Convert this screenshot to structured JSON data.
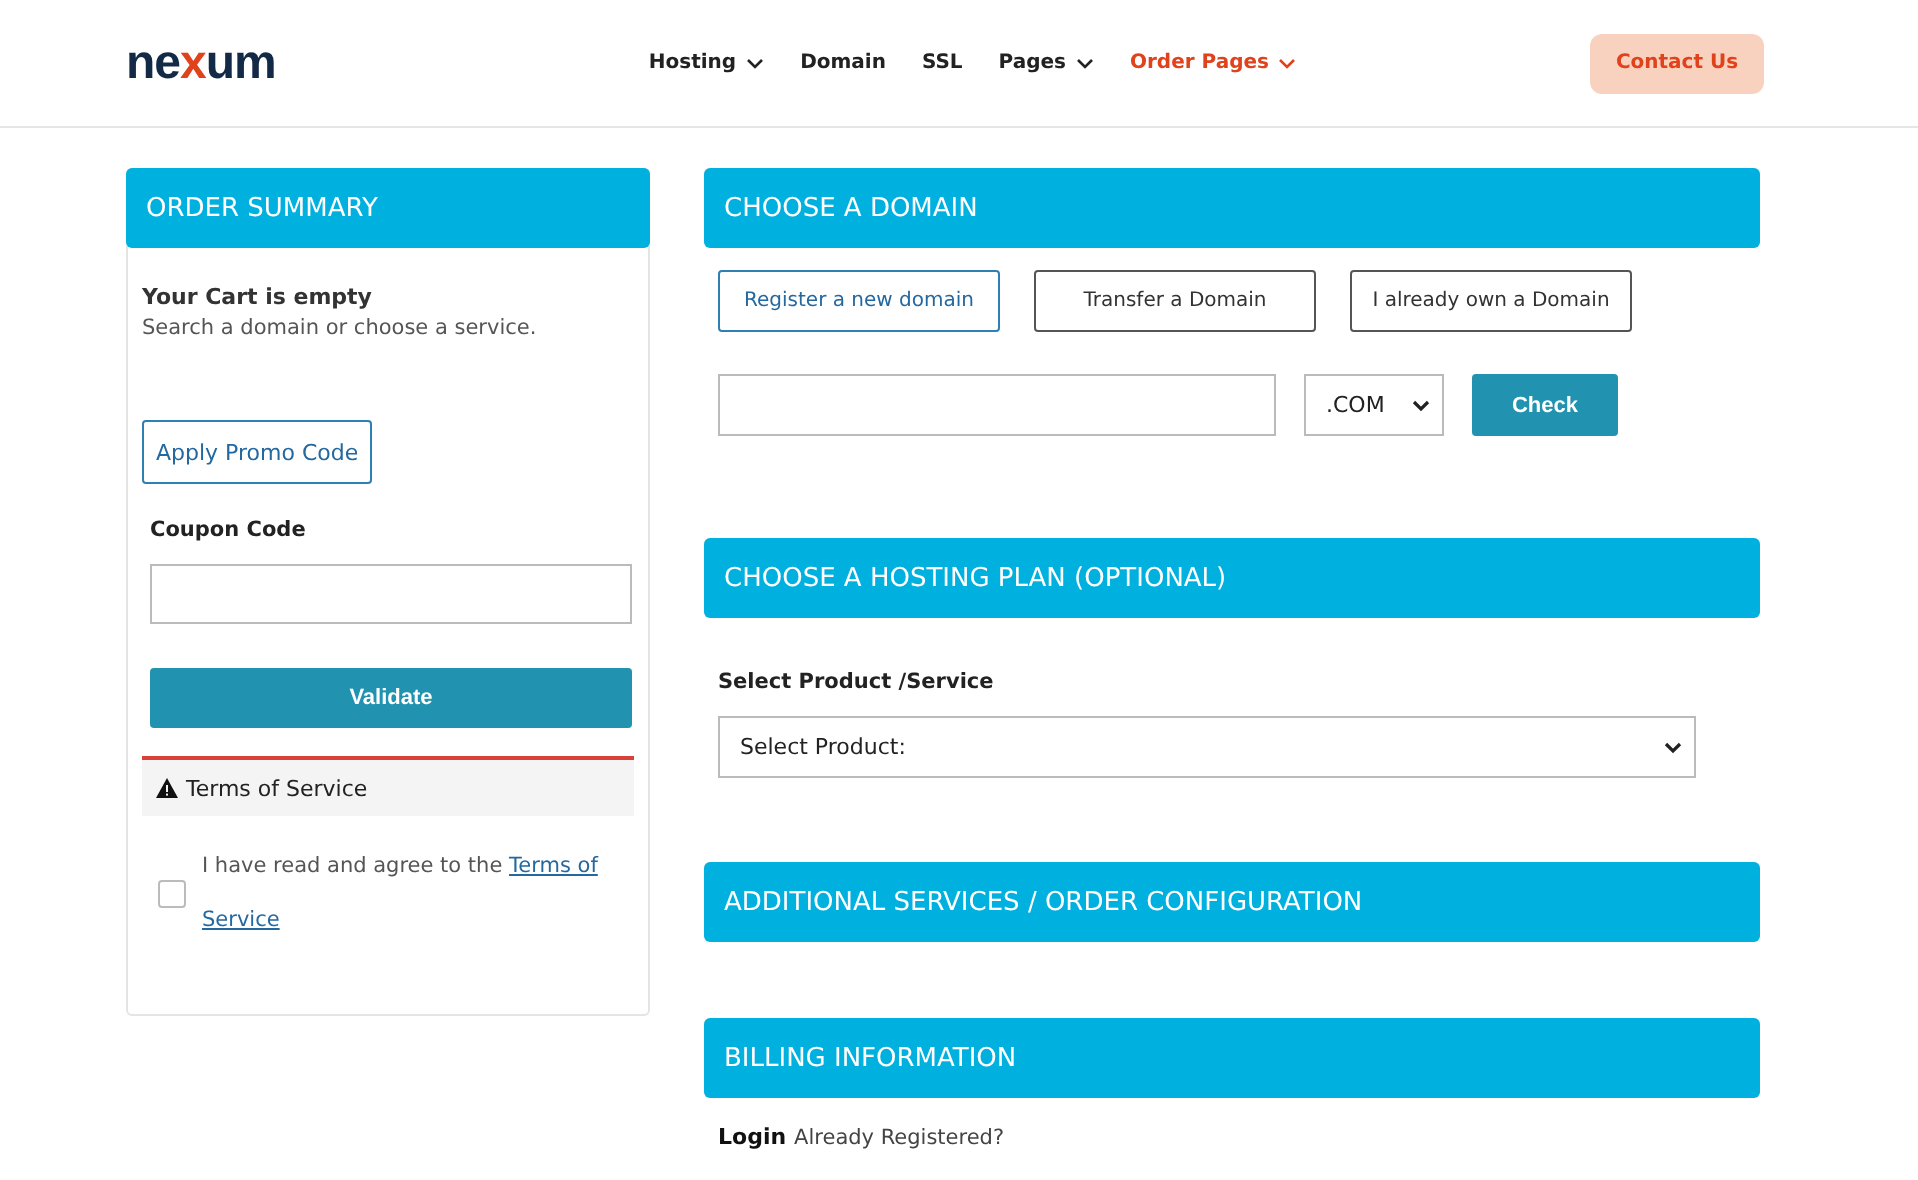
{
  "header": {
    "logo": {
      "before": "ne",
      "accent": "x",
      "after": "um"
    },
    "nav": [
      {
        "label": "Hosting",
        "dropdown": true,
        "selected": false
      },
      {
        "label": "Domain",
        "dropdown": false,
        "selected": false
      },
      {
        "label": "SSL",
        "dropdown": false,
        "selected": false
      },
      {
        "label": "Pages",
        "dropdown": true,
        "selected": false
      },
      {
        "label": "Order Pages",
        "dropdown": true,
        "selected": true
      }
    ],
    "contact_button": "Contact Us"
  },
  "order_summary": {
    "title": "ORDER SUMMARY",
    "cart_title": "Your Cart is empty",
    "cart_hint": "Search a domain or choose a service.",
    "promo_button": "Apply Promo Code",
    "coupon_label": "Coupon Code",
    "validate_button": "Validate",
    "terms": {
      "title": "Terms of Service",
      "text": "I have read and agree to the ",
      "link": [
        "Terms of",
        "Service"
      ],
      "checked": false
    }
  },
  "domain": {
    "title": "CHOOSE A DOMAIN",
    "options": [
      {
        "label": "Register a new domain",
        "selected": true
      },
      {
        "label": "Transfer a Domain",
        "selected": false
      },
      {
        "label": "I already own a Domain",
        "selected": false
      }
    ],
    "tld": ".COM",
    "check_button": "Check"
  },
  "hosting": {
    "title": "CHOOSE A HOSTING PLAN (OPTIONAL)",
    "label": "Select Product /Service",
    "select": "Select Product:"
  },
  "additional": {
    "title": "ADDITIONAL SERVICES / ORDER CONFIGURATION"
  },
  "billing": {
    "title": "BILLING INFORMATION",
    "login": "Login",
    "login_hint": "Already Registered?"
  }
}
